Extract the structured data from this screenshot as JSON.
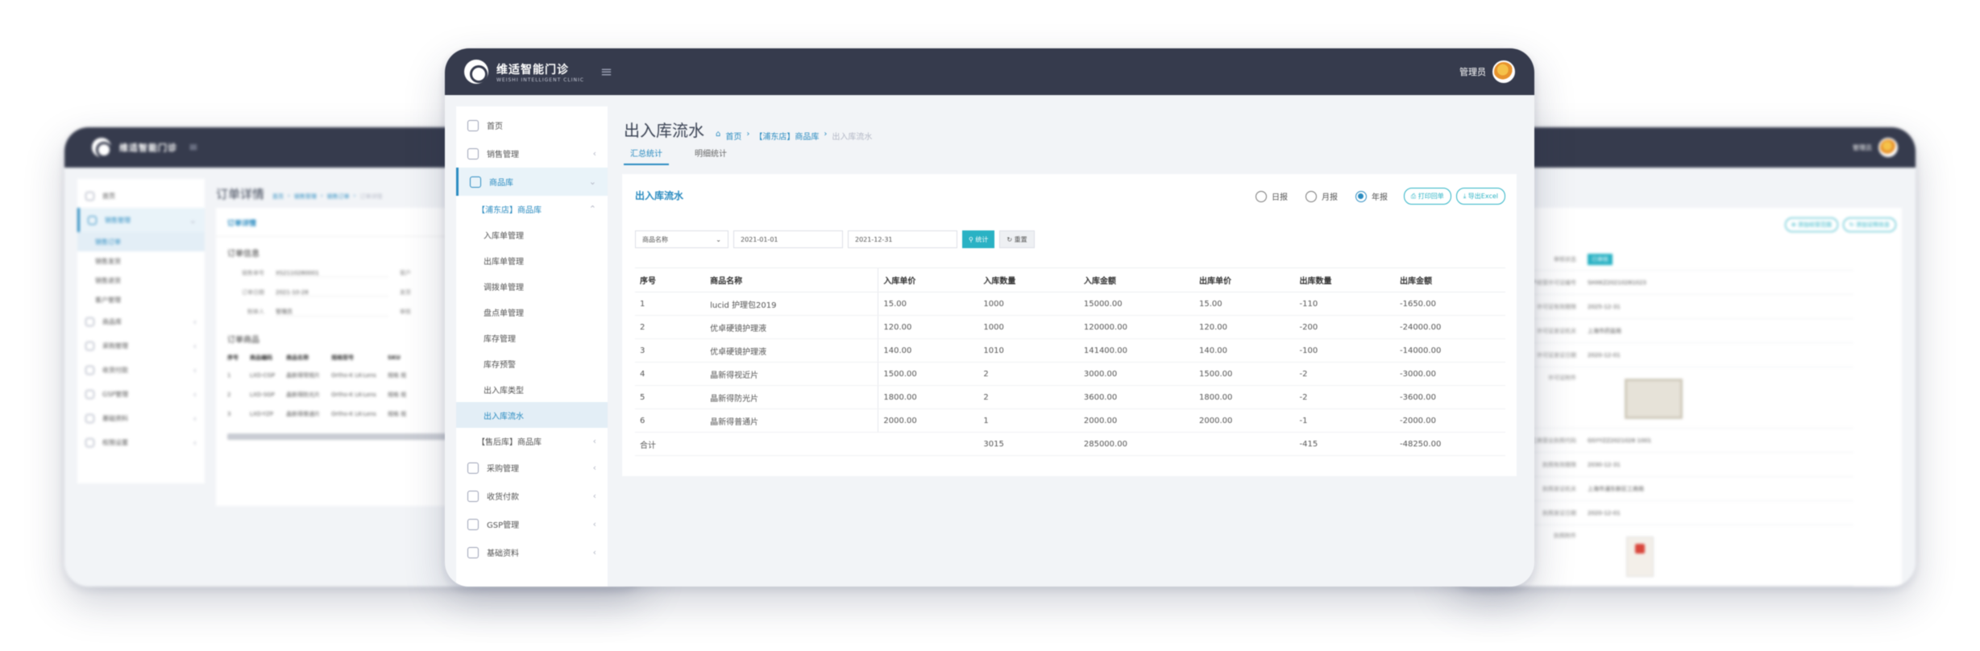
{
  "brand": {
    "name": "维适智能门诊",
    "tagline": "WEISHI INTELLIGENT CLINIC"
  },
  "user": {
    "name": "管理员"
  },
  "main": {
    "title": "出入库流水",
    "breadcrumb": [
      "首页",
      "【浦东店】商品库",
      "出入库流水"
    ],
    "tabs": [
      {
        "label": "汇总统计",
        "active": true
      },
      {
        "label": "明细统计",
        "active": false
      }
    ],
    "card_title": "出入库流水",
    "period_options": [
      {
        "label": "日报",
        "checked": false
      },
      {
        "label": "月报",
        "checked": false
      },
      {
        "label": "年报",
        "checked": true
      }
    ],
    "print_label": "打印回单",
    "export_label": "导出Excel",
    "filter_select": "商品名称",
    "date_from": "2021-01-01",
    "date_to": "2021-12-31",
    "query_label": "统计",
    "reset_label": "重置",
    "columns": [
      "序号",
      "商品名称",
      "入库单价",
      "入库数量",
      "入库金额",
      "出库单价",
      "出库数量",
      "出库金额"
    ],
    "rows": [
      [
        "1",
        "lucid 护理包2019",
        "15.00",
        "1000",
        "15000.00",
        "15.00",
        "-110",
        "-1650.00"
      ],
      [
        "2",
        "优卓硬镜护理液",
        "120.00",
        "1000",
        "120000.00",
        "120.00",
        "-200",
        "-24000.00"
      ],
      [
        "3",
        "优卓硬镜护理液",
        "140.00",
        "1010",
        "141400.00",
        "140.00",
        "-100",
        "-14000.00"
      ],
      [
        "4",
        "晶新得视近片",
        "1500.00",
        "2",
        "3000.00",
        "1500.00",
        "-2",
        "-3000.00"
      ],
      [
        "5",
        "晶新得防光片",
        "1800.00",
        "2",
        "3600.00",
        "1800.00",
        "-2",
        "-3600.00"
      ],
      [
        "6",
        "晶新得普通片",
        "2000.00",
        "1",
        "2000.00",
        "2000.00",
        "-1",
        "-2000.00"
      ]
    ],
    "total_row": [
      "合计",
      "",
      "",
      "3015",
      "285000.00",
      "",
      "-415",
      "-48250.00"
    ]
  },
  "sidebar_front": {
    "top_items": [
      {
        "label": "首页",
        "arrow": ""
      },
      {
        "label": "销售管理",
        "arrow": "‹"
      },
      {
        "label": "商品库",
        "arrow": "⌄",
        "active": true
      }
    ],
    "group_label": "【浦东店】商品库",
    "sub_items": [
      "入库单管理",
      "出库单管理",
      "调拨单管理",
      "盘点单管理",
      "库存管理",
      "库存预警",
      "出入库类型",
      "出入库流水"
    ],
    "selected_sub": "出入库流水",
    "group2_label": "【售后库】商品库",
    "bottom_items": [
      {
        "label": "采购管理",
        "arrow": "‹"
      },
      {
        "label": "收货付款",
        "arrow": "‹"
      },
      {
        "label": "GSP管理",
        "arrow": "‹"
      },
      {
        "label": "基础资料",
        "arrow": "‹"
      }
    ]
  },
  "order": {
    "title": "订单详情",
    "breadcrumb": [
      "首页",
      "销售管理",
      "销售订单",
      "订单详情"
    ],
    "card_title": "订单详情",
    "info_title": "订单信息",
    "fields": [
      {
        "k": "销售单号",
        "v": "XS2110280001",
        "k2": "客户"
      },
      {
        "k": "订单日期",
        "v": "2021-10-28",
        "k2": "发货"
      },
      {
        "k": "制单人",
        "v": "管理员",
        "k2": "审核"
      }
    ],
    "goods_title": "订单商品",
    "goods_columns": [
      "序号",
      "商品编码",
      "商品名称",
      "规格型号",
      "SKU"
    ],
    "goods_rows": [
      [
        "1",
        "LXD-CGP",
        "晶新得常规片",
        "Ortho-K LK-Lens",
        "规格 规"
      ],
      [
        "2",
        "LXD-SGP",
        "晶新得防光片",
        "Ortho-K LK-Lens",
        "规格 规"
      ],
      [
        "3",
        "LXD-YZP",
        "晶新得普通片",
        "Ortho-K LK-Lens",
        "规格 规"
      ]
    ]
  },
  "sidebar_left": {
    "items": [
      {
        "label": "首页",
        "arrow": ""
      },
      {
        "label": "销售管理",
        "arrow": "⌄",
        "active": true
      }
    ],
    "sub_items": [
      "销售订单",
      "销售发货",
      "销售退货",
      "客户管理"
    ],
    "selected_sub": "销售订单",
    "more_items": [
      {
        "label": "商品库",
        "arrow": "‹"
      },
      {
        "label": "采购管理",
        "arrow": "‹"
      },
      {
        "label": "收货付款",
        "arrow": "‹"
      },
      {
        "label": "GSP管理",
        "arrow": "‹"
      },
      {
        "label": "基础资料",
        "arrow": "‹"
      },
      {
        "label": "权限设置",
        "arrow": "‹"
      }
    ]
  },
  "supplier": {
    "btn1": "添加经营范围",
    "btn2": "添加证照信息",
    "status_key": "审核状态",
    "status_value": "已审核",
    "fields": [
      {
        "k": "生产经营许可证编号",
        "v": "SHXKZ20210281023"
      },
      {
        "k": "许可证有效期限",
        "v": "2025-12-31"
      },
      {
        "k": "许可证发证机关",
        "v": "上海市药监局"
      },
      {
        "k": "许可证发证日期",
        "v": "2020-12-01"
      },
      {
        "k": "许可证附件",
        "v": ""
      },
      {
        "k": "工商营业执照代码",
        "v": "GSYYZZ2021028 1001"
      },
      {
        "k": "执照有效期限",
        "v": "2030-12-31"
      },
      {
        "k": "执照发证机关",
        "v": "上海市浦东新区工商局"
      },
      {
        "k": "执照发证日期",
        "v": "2020-12-01"
      },
      {
        "k": "执照附件",
        "v": ""
      }
    ]
  }
}
